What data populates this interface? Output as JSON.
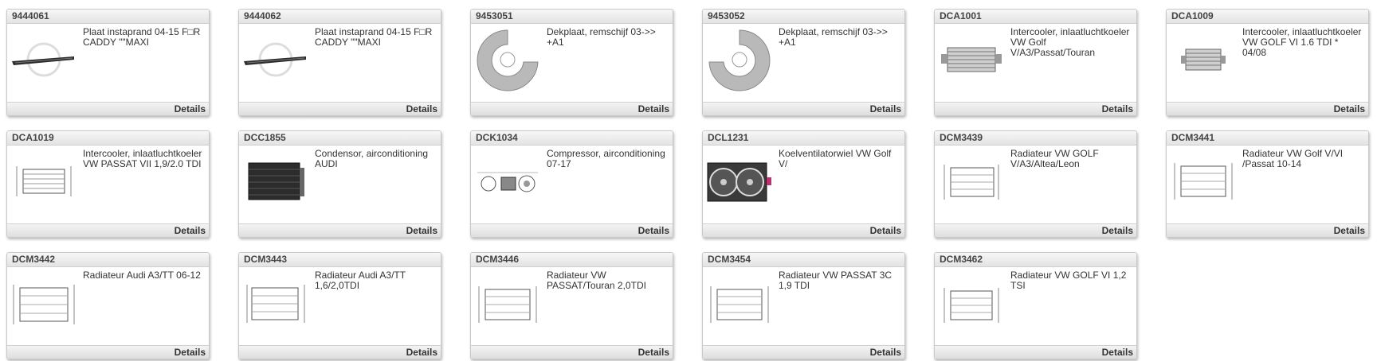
{
  "products": [
    {
      "sku": "9444061",
      "desc": "Plaat instaprand 04-15 F□R CADDY \"\"MAXI",
      "icon": "step-plate",
      "details": "Details"
    },
    {
      "sku": "9444062",
      "desc": "Plaat instaprand 04-15 F□R CADDY \"\"MAXI",
      "icon": "step-plate",
      "details": "Details"
    },
    {
      "sku": "9453051",
      "desc": "Dekplaat, remschijf 03->> +A1",
      "icon": "brake-shield",
      "details": "Details"
    },
    {
      "sku": "9453052",
      "desc": "Dekplaat, remschijf 03->> +A1",
      "icon": "brake-shield",
      "details": "Details"
    },
    {
      "sku": "DCA1001",
      "desc": "Intercooler, inlaatluchtkoeler VW Golf V/A3/Passat/Touran",
      "icon": "intercooler",
      "details": "Details"
    },
    {
      "sku": "DCA1009",
      "desc": "Intercooler, inlaatluchtkoeler VW GOLF VI 1.6 TDI * 04/08",
      "icon": "intercooler",
      "details": "Details"
    },
    {
      "sku": "DCA1019",
      "desc": "Intercooler, inlaatluchtkoeler VW PASSAT VII 1,9/2.0 TDI",
      "icon": "intercooler-drawing",
      "details": "Details"
    },
    {
      "sku": "DCC1855",
      "desc": "Condensor, airconditioning AUDI",
      "icon": "condenser",
      "details": "Details"
    },
    {
      "sku": "DCK1034",
      "desc": "Compressor, airconditioning 07-17",
      "icon": "compressor",
      "details": "Details"
    },
    {
      "sku": "DCL1231",
      "desc": "Koelventilatorwiel VW Golf V/",
      "icon": "fan",
      "details": "Details"
    },
    {
      "sku": "DCM3439",
      "desc": "Radiateur VW GOLF V/A3/Altea/Leon",
      "icon": "radiator-drawing",
      "details": "Details"
    },
    {
      "sku": "DCM3441",
      "desc": "Radiateur VW Golf V/VI /Passat 10-14",
      "icon": "radiator-drawing",
      "details": "Details"
    },
    {
      "sku": "DCM3442",
      "desc": "Radiateur Audi A3/TT 06-12",
      "icon": "radiator-drawing",
      "details": "Details"
    },
    {
      "sku": "DCM3443",
      "desc": "Radiateur Audi A3/TT 1,6/2,0TDI",
      "icon": "radiator-drawing",
      "details": "Details"
    },
    {
      "sku": "DCM3446",
      "desc": "Radiateur VW PASSAT/Touran 2,0TDI",
      "icon": "radiator-drawing",
      "details": "Details"
    },
    {
      "sku": "DCM3454",
      "desc": "Radiateur VW PASSAT 3C 1,9 TDI",
      "icon": "radiator-drawing",
      "details": "Details"
    },
    {
      "sku": "DCM3462",
      "desc": "Radiateur VW GOLF VI 1,2 TSI",
      "icon": "radiator-drawing",
      "details": "Details"
    }
  ]
}
